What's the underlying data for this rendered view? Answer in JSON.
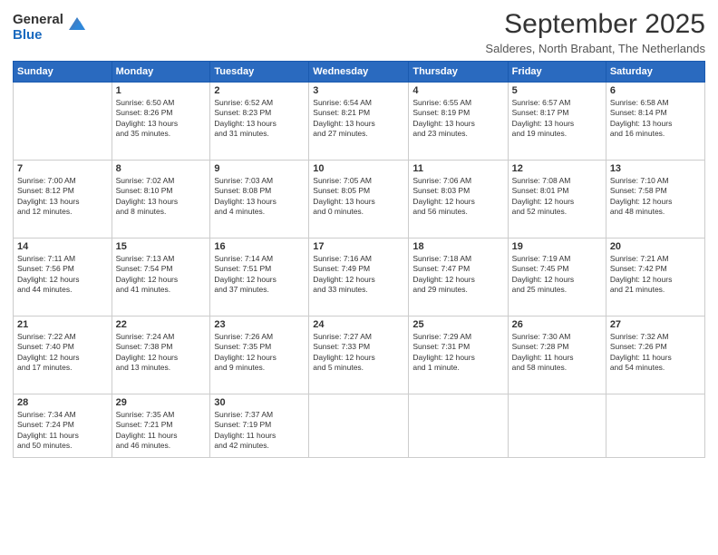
{
  "logo": {
    "general": "General",
    "blue": "Blue"
  },
  "header": {
    "month": "September 2025",
    "location": "Salderes, North Brabant, The Netherlands"
  },
  "weekdays": [
    "Sunday",
    "Monday",
    "Tuesday",
    "Wednesday",
    "Thursday",
    "Friday",
    "Saturday"
  ],
  "weeks": [
    [
      {
        "day": "",
        "detail": ""
      },
      {
        "day": "1",
        "detail": "Sunrise: 6:50 AM\nSunset: 8:26 PM\nDaylight: 13 hours\nand 35 minutes."
      },
      {
        "day": "2",
        "detail": "Sunrise: 6:52 AM\nSunset: 8:23 PM\nDaylight: 13 hours\nand 31 minutes."
      },
      {
        "day": "3",
        "detail": "Sunrise: 6:54 AM\nSunset: 8:21 PM\nDaylight: 13 hours\nand 27 minutes."
      },
      {
        "day": "4",
        "detail": "Sunrise: 6:55 AM\nSunset: 8:19 PM\nDaylight: 13 hours\nand 23 minutes."
      },
      {
        "day": "5",
        "detail": "Sunrise: 6:57 AM\nSunset: 8:17 PM\nDaylight: 13 hours\nand 19 minutes."
      },
      {
        "day": "6",
        "detail": "Sunrise: 6:58 AM\nSunset: 8:14 PM\nDaylight: 13 hours\nand 16 minutes."
      }
    ],
    [
      {
        "day": "7",
        "detail": "Sunrise: 7:00 AM\nSunset: 8:12 PM\nDaylight: 13 hours\nand 12 minutes."
      },
      {
        "day": "8",
        "detail": "Sunrise: 7:02 AM\nSunset: 8:10 PM\nDaylight: 13 hours\nand 8 minutes."
      },
      {
        "day": "9",
        "detail": "Sunrise: 7:03 AM\nSunset: 8:08 PM\nDaylight: 13 hours\nand 4 minutes."
      },
      {
        "day": "10",
        "detail": "Sunrise: 7:05 AM\nSunset: 8:05 PM\nDaylight: 13 hours\nand 0 minutes."
      },
      {
        "day": "11",
        "detail": "Sunrise: 7:06 AM\nSunset: 8:03 PM\nDaylight: 12 hours\nand 56 minutes."
      },
      {
        "day": "12",
        "detail": "Sunrise: 7:08 AM\nSunset: 8:01 PM\nDaylight: 12 hours\nand 52 minutes."
      },
      {
        "day": "13",
        "detail": "Sunrise: 7:10 AM\nSunset: 7:58 PM\nDaylight: 12 hours\nand 48 minutes."
      }
    ],
    [
      {
        "day": "14",
        "detail": "Sunrise: 7:11 AM\nSunset: 7:56 PM\nDaylight: 12 hours\nand 44 minutes."
      },
      {
        "day": "15",
        "detail": "Sunrise: 7:13 AM\nSunset: 7:54 PM\nDaylight: 12 hours\nand 41 minutes."
      },
      {
        "day": "16",
        "detail": "Sunrise: 7:14 AM\nSunset: 7:51 PM\nDaylight: 12 hours\nand 37 minutes."
      },
      {
        "day": "17",
        "detail": "Sunrise: 7:16 AM\nSunset: 7:49 PM\nDaylight: 12 hours\nand 33 minutes."
      },
      {
        "day": "18",
        "detail": "Sunrise: 7:18 AM\nSunset: 7:47 PM\nDaylight: 12 hours\nand 29 minutes."
      },
      {
        "day": "19",
        "detail": "Sunrise: 7:19 AM\nSunset: 7:45 PM\nDaylight: 12 hours\nand 25 minutes."
      },
      {
        "day": "20",
        "detail": "Sunrise: 7:21 AM\nSunset: 7:42 PM\nDaylight: 12 hours\nand 21 minutes."
      }
    ],
    [
      {
        "day": "21",
        "detail": "Sunrise: 7:22 AM\nSunset: 7:40 PM\nDaylight: 12 hours\nand 17 minutes."
      },
      {
        "day": "22",
        "detail": "Sunrise: 7:24 AM\nSunset: 7:38 PM\nDaylight: 12 hours\nand 13 minutes."
      },
      {
        "day": "23",
        "detail": "Sunrise: 7:26 AM\nSunset: 7:35 PM\nDaylight: 12 hours\nand 9 minutes."
      },
      {
        "day": "24",
        "detail": "Sunrise: 7:27 AM\nSunset: 7:33 PM\nDaylight: 12 hours\nand 5 minutes."
      },
      {
        "day": "25",
        "detail": "Sunrise: 7:29 AM\nSunset: 7:31 PM\nDaylight: 12 hours\nand 1 minute."
      },
      {
        "day": "26",
        "detail": "Sunrise: 7:30 AM\nSunset: 7:28 PM\nDaylight: 11 hours\nand 58 minutes."
      },
      {
        "day": "27",
        "detail": "Sunrise: 7:32 AM\nSunset: 7:26 PM\nDaylight: 11 hours\nand 54 minutes."
      }
    ],
    [
      {
        "day": "28",
        "detail": "Sunrise: 7:34 AM\nSunset: 7:24 PM\nDaylight: 11 hours\nand 50 minutes."
      },
      {
        "day": "29",
        "detail": "Sunrise: 7:35 AM\nSunset: 7:21 PM\nDaylight: 11 hours\nand 46 minutes."
      },
      {
        "day": "30",
        "detail": "Sunrise: 7:37 AM\nSunset: 7:19 PM\nDaylight: 11 hours\nand 42 minutes."
      },
      {
        "day": "",
        "detail": ""
      },
      {
        "day": "",
        "detail": ""
      },
      {
        "day": "",
        "detail": ""
      },
      {
        "day": "",
        "detail": ""
      }
    ]
  ]
}
